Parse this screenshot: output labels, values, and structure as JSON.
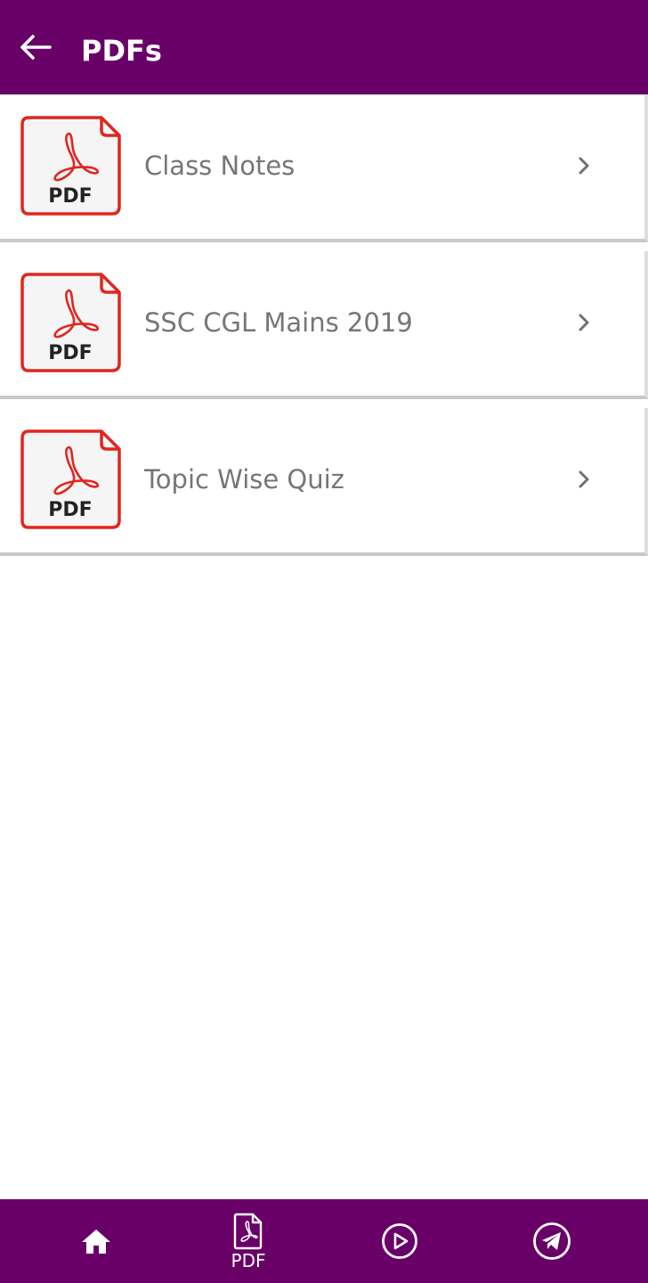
{
  "header": {
    "title": "PDFs",
    "back_icon": "arrow-left-icon"
  },
  "colors": {
    "primary": "#690068",
    "pdf_red": "#e0261f",
    "label_gray": "#767676"
  },
  "items": [
    {
      "label": "Class Notes",
      "icon_text": "PDF"
    },
    {
      "label": "SSC CGL Mains 2019",
      "icon_text": "PDF"
    },
    {
      "label": "Topic Wise Quiz",
      "icon_text": "PDF"
    }
  ],
  "bottom_nav": {
    "items": [
      {
        "icon": "home-icon",
        "label": ""
      },
      {
        "icon": "pdf-icon",
        "label": "PDF"
      },
      {
        "icon": "play-circle-icon",
        "label": ""
      },
      {
        "icon": "telegram-icon",
        "label": ""
      }
    ]
  }
}
